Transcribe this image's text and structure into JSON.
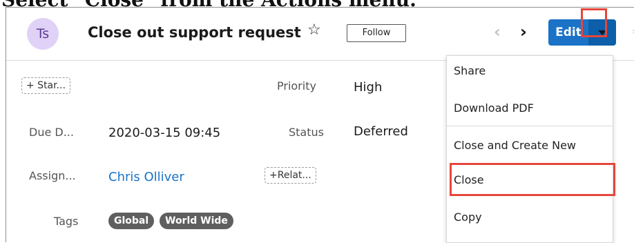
{
  "caption": "Select \"Close\" from the Actions menu.",
  "record": {
    "avatar_initials": "Ts",
    "title": "Close out support request",
    "follow_label": "Follow",
    "edit_label": "Edit"
  },
  "fields": {
    "start_button": "+ Star...",
    "priority_label": "Priority",
    "priority_value": "High",
    "due_label": "Due D...",
    "due_value": "2020-03-15 09:45",
    "status_label": "Status",
    "status_value": "Deferred",
    "assigned_label": "Assign...",
    "assigned_value": "Chris Olliver",
    "related_button": "+Relat...",
    "tags_label": "Tags",
    "tags": [
      "Global",
      "World Wide"
    ]
  },
  "actions_menu": {
    "items": [
      "Share",
      "Download PDF",
      "Close and Create New",
      "Close",
      "Copy"
    ]
  },
  "colors": {
    "highlight": "#e5463a",
    "primary": "#1a73c7"
  }
}
